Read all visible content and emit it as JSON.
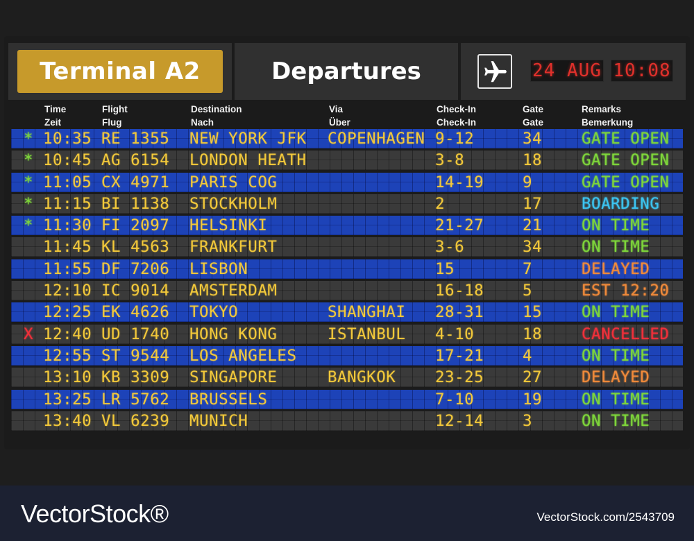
{
  "header": {
    "terminal": "Terminal A2",
    "title": "Departures",
    "plane_icon": "airplane-icon",
    "date": "24 AUG",
    "time": "10:08"
  },
  "columns": [
    {
      "line1": "Time",
      "line2": "Zeit"
    },
    {
      "line1": "Flight",
      "line2": "Flug"
    },
    {
      "line1": "Destination",
      "line2": "Nach"
    },
    {
      "line1": "Via",
      "line2": "Über"
    },
    {
      "line1": "Check-In",
      "line2": "Check-In"
    },
    {
      "line1": "Gate",
      "line2": "Gate"
    },
    {
      "line1": "Remarks",
      "line2": "Bemerkung"
    }
  ],
  "colors": {
    "amber": "#f3c93a",
    "green": "#7ed63a",
    "cyan": "#3cc4f0",
    "orange": "#f08a3a",
    "red": "#f0303a",
    "row_blue": "#1d43b8",
    "row_gray": "#3a3a3a"
  },
  "flights": [
    {
      "flag": "*",
      "flag_color": "green",
      "time": "10:35",
      "flight": "RE 1355",
      "destination": "NEW YORK JFK",
      "via": "COPENHAGEN",
      "checkin": "9-12",
      "gate": "34",
      "remark": "GATE OPEN",
      "remark_color": "green",
      "row": "blue"
    },
    {
      "flag": "*",
      "flag_color": "green",
      "time": "10:45",
      "flight": "AG 6154",
      "destination": "LONDON HEATH",
      "via": "",
      "checkin": "3-8",
      "gate": "18",
      "remark": "GATE OPEN",
      "remark_color": "green",
      "row": "gray"
    },
    {
      "flag": "*",
      "flag_color": "green",
      "time": "11:05",
      "flight": "CX 4971",
      "destination": "PARIS COG",
      "via": "",
      "checkin": "14-19",
      "gate": "9",
      "remark": "GATE OPEN",
      "remark_color": "green",
      "row": "blue"
    },
    {
      "flag": "*",
      "flag_color": "green",
      "time": "11:15",
      "flight": "BI 1138",
      "destination": "STOCKHOLM",
      "via": "",
      "checkin": "2",
      "gate": "17",
      "remark": "BOARDING",
      "remark_color": "cyan",
      "row": "gray"
    },
    {
      "flag": "*",
      "flag_color": "green",
      "time": "11:30",
      "flight": "FI 2097",
      "destination": "HELSINKI",
      "via": "",
      "checkin": "21-27",
      "gate": "21",
      "remark": "ON TIME",
      "remark_color": "green",
      "row": "blue"
    },
    {
      "flag": "",
      "flag_color": "green",
      "time": "11:45",
      "flight": "KL 4563",
      "destination": "FRANKFURT",
      "via": "",
      "checkin": "3-6",
      "gate": "34",
      "remark": "ON TIME",
      "remark_color": "green",
      "row": "gray"
    },
    {
      "flag": "",
      "flag_color": "green",
      "time": "11:55",
      "flight": "DF 7206",
      "destination": "LISBON",
      "via": "",
      "checkin": "15",
      "gate": "7",
      "remark": "DELAYED",
      "remark_color": "orange",
      "row": "blue"
    },
    {
      "flag": "",
      "flag_color": "green",
      "time": "12:10",
      "flight": "IC 9014",
      "destination": "AMSTERDAM",
      "via": "",
      "checkin": "16-18",
      "gate": "5",
      "remark": "EST 12:20",
      "remark_color": "orange",
      "row": "gray"
    },
    {
      "flag": "",
      "flag_color": "green",
      "time": "12:25",
      "flight": "EK 4626",
      "destination": "TOKYO",
      "via": "SHANGHAI",
      "checkin": "28-31",
      "gate": "15",
      "remark": "ON TIME",
      "remark_color": "green",
      "row": "blue"
    },
    {
      "flag": "X",
      "flag_color": "red",
      "time": "12:40",
      "flight": "UD 1740",
      "destination": "HONG KONG",
      "via": "ISTANBUL",
      "checkin": "4-10",
      "gate": "18",
      "remark": "CANCELLED",
      "remark_color": "red",
      "row": "gray"
    },
    {
      "flag": "",
      "flag_color": "green",
      "time": "12:55",
      "flight": "ST 9544",
      "destination": "LOS ANGELES",
      "via": "",
      "checkin": "17-21",
      "gate": "4",
      "remark": "ON TIME",
      "remark_color": "green",
      "row": "blue"
    },
    {
      "flag": "",
      "flag_color": "green",
      "time": "13:10",
      "flight": "KB 3309",
      "destination": "SINGAPORE",
      "via": "BANGKOK",
      "checkin": "23-25",
      "gate": "27",
      "remark": "DELAYED",
      "remark_color": "orange",
      "row": "gray"
    },
    {
      "flag": "",
      "flag_color": "green",
      "time": "13:25",
      "flight": "LR 5762",
      "destination": "BRUSSELS",
      "via": "",
      "checkin": "7-10",
      "gate": "19",
      "remark": "ON TIME",
      "remark_color": "green",
      "row": "blue"
    },
    {
      "flag": "",
      "flag_color": "green",
      "time": "13:40",
      "flight": "VL 6239",
      "destination": "MUNICH",
      "via": "",
      "checkin": "12-14",
      "gate": "3",
      "remark": "ON TIME",
      "remark_color": "green",
      "row": "gray"
    }
  ],
  "footer": {
    "brand": "VectorStock®",
    "image_id": "VectorStock.com/2543709"
  }
}
